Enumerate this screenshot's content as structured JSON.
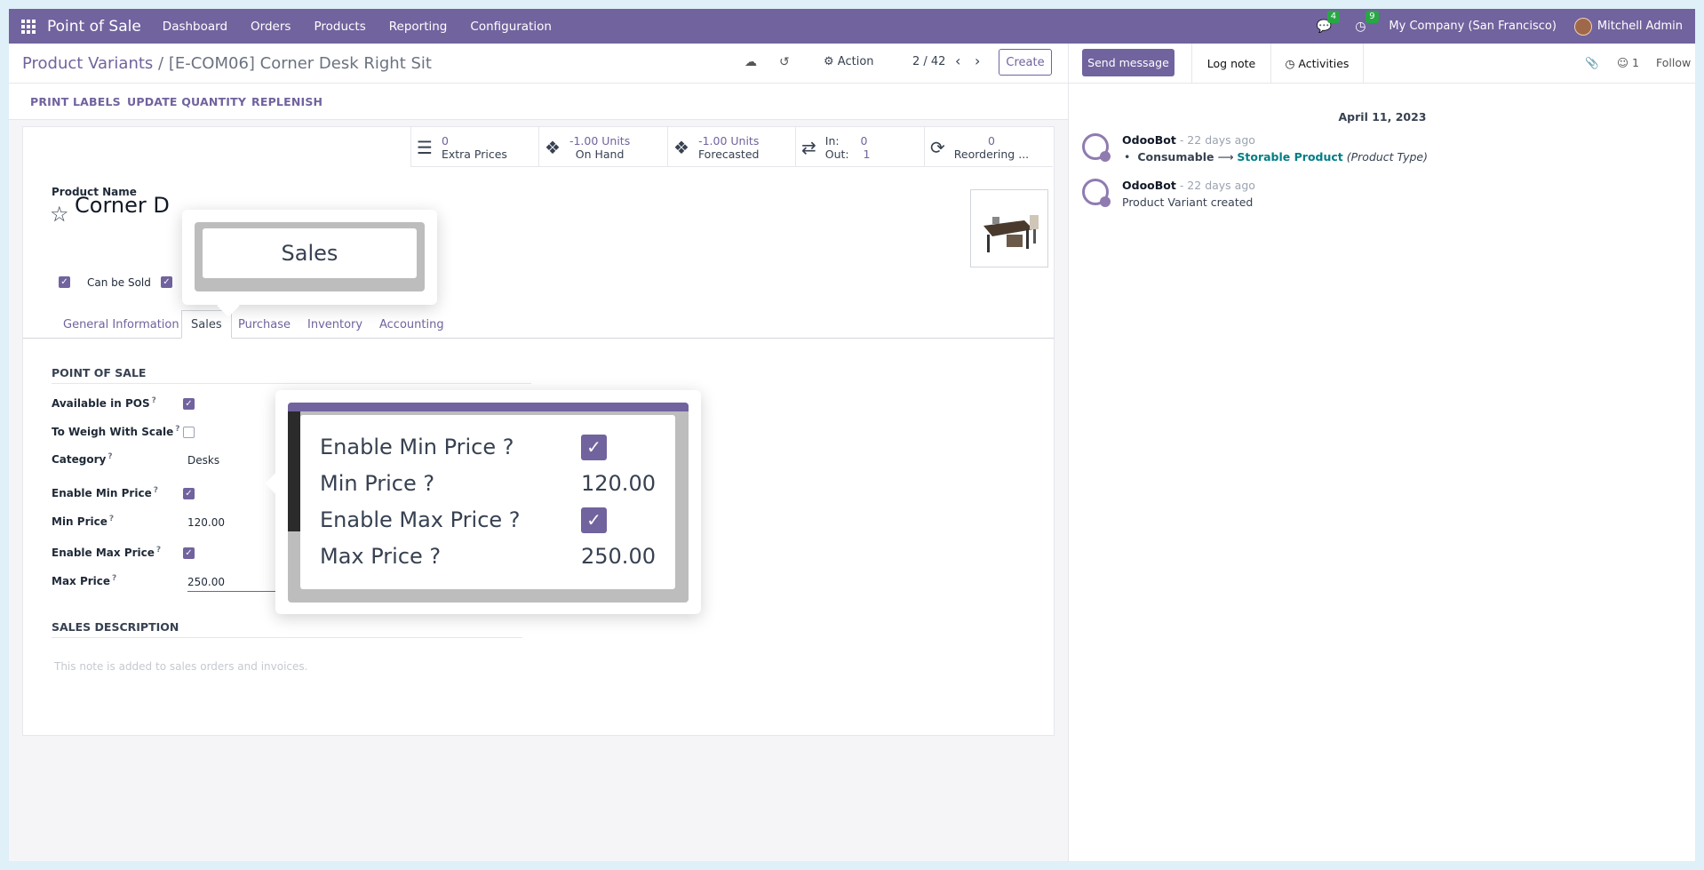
{
  "topbar": {
    "app_title": "Point of Sale",
    "menu": [
      "Dashboard",
      "Orders",
      "Products",
      "Reporting",
      "Configuration"
    ],
    "messages_badge": "4",
    "activities_badge": "9",
    "company": "My Company (San Francisco)",
    "user": "Mitchell Admin"
  },
  "control": {
    "breadcrumb_parent": "Product Variants",
    "breadcrumb_separator": "/",
    "breadcrumb_current": "[E-COM06] Corner Desk Right Sit",
    "action_label": "Action",
    "pager": "2 / 42",
    "create_label": "Create"
  },
  "statusbar": {
    "buttons": [
      "PRINT LABELS",
      "UPDATE QUANTITY",
      "REPLENISH"
    ]
  },
  "smart_buttons": {
    "extra_prices": {
      "value": "0",
      "label": "Extra Prices"
    },
    "on_hand": {
      "value": "-1.00 Units",
      "label": "On Hand"
    },
    "forecasted": {
      "value": "-1.00 Units",
      "label": "Forecasted"
    },
    "in_out": {
      "in_label": "In:",
      "in_value": "0",
      "out_label": "Out:",
      "out_value": "1"
    },
    "reordering": {
      "value": "0",
      "label": "Reordering ..."
    }
  },
  "form": {
    "product_name_label": "Product Name",
    "product_name": "Corner D",
    "can_be_sold_label": "Can be Sold",
    "tabs": [
      "General Information",
      "Sales",
      "Purchase",
      "Inventory",
      "Accounting"
    ],
    "pos_section": "POINT OF SALE",
    "fields": {
      "available_in_pos": "Available in POS",
      "to_weigh": "To Weigh With Scale",
      "category": "Category",
      "category_value": "Desks",
      "enable_min": "Enable Min Price",
      "min_price": "Min Price",
      "min_price_value": "120.00",
      "enable_max": "Enable Max Price",
      "max_price": "Max Price",
      "max_price_value": "250.00"
    },
    "sales_desc_section": "SALES DESCRIPTION",
    "sales_desc_placeholder": "This note is added to sales orders and invoices."
  },
  "zoom_tab": {
    "label": "Sales"
  },
  "zoom_fields": {
    "enable_min": "Enable Min Price ?",
    "min_price": "Min Price ?",
    "min_value": "120.00",
    "enable_max": "Enable Max Price ?",
    "max_price": "Max Price ?",
    "max_value": "250.00"
  },
  "chatter": {
    "send_message": "Send message",
    "log_note": "Log note",
    "activities": "Activities",
    "followers_count": "1",
    "follow": "Follow",
    "date": "April 11, 2023",
    "messages": [
      {
        "author": "OdooBot",
        "ago": "- 22 days ago",
        "old": "Consumable",
        "arrow": "⟶",
        "new": "Storable Product",
        "field": "(Product Type)"
      },
      {
        "author": "OdooBot",
        "ago": "- 22 days ago",
        "text": "Product Variant created"
      }
    ]
  },
  "colors": {
    "brand": "#71639e",
    "success_badge": "#28a745",
    "link": "#017e84"
  }
}
